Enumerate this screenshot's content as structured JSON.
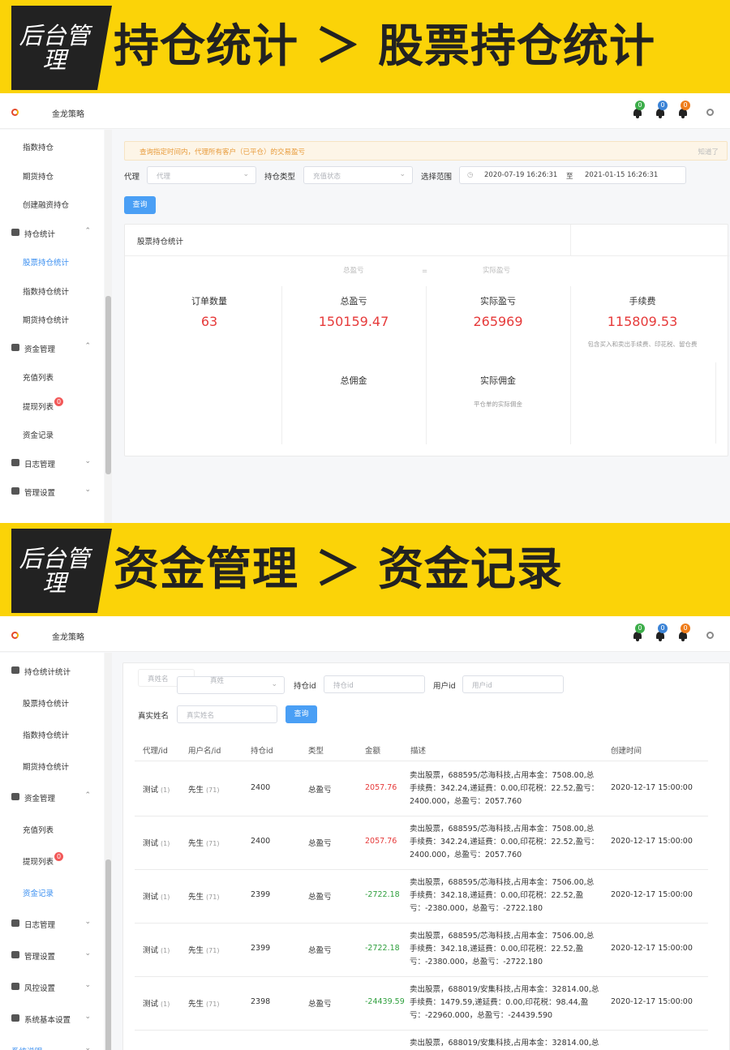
{
  "banner1": {
    "badge": "后台管理",
    "title": "持仓统计 ＞ 股票持仓统计"
  },
  "banner2": {
    "badge": "后台管理",
    "title": "资金管理 ＞ 资金记录"
  },
  "topbar": {
    "brand": "金龙策略",
    "badges": [
      {
        "count": "0",
        "color": "#3cad4a"
      },
      {
        "count": "0",
        "color": "#3b83d6"
      },
      {
        "count": "0",
        "color": "#ef7d1b"
      }
    ]
  },
  "screen1": {
    "sidebar": [
      {
        "label": "指数持仓",
        "kind": "sub"
      },
      {
        "label": "期货持仓",
        "kind": "sub"
      },
      {
        "label": "创建融资持仓",
        "kind": "sub"
      },
      {
        "label": "持仓统计",
        "kind": "grp",
        "arrow": "^"
      },
      {
        "label": "股票持仓统计",
        "kind": "sub",
        "active": true
      },
      {
        "label": "指数持仓统计",
        "kind": "sub"
      },
      {
        "label": "期货持仓统计",
        "kind": "sub"
      },
      {
        "label": "资金管理",
        "kind": "grp",
        "arrow": "^"
      },
      {
        "label": "充值列表",
        "kind": "sub"
      },
      {
        "label": "提现列表",
        "kind": "sub",
        "dot": "0"
      },
      {
        "label": "资金记录",
        "kind": "sub"
      },
      {
        "label": "日志管理",
        "kind": "grp",
        "arrow": "v"
      },
      {
        "label": "管理设置",
        "kind": "grp",
        "arrow": "v"
      }
    ],
    "alert": {
      "text": "查询指定时间内，代理所有客户（已平仓）的交易盈亏",
      "close": "知道了"
    },
    "filters": {
      "agent_label": "代理",
      "agent_placeholder": "代理",
      "type_label": "持仓类型",
      "type_placeholder": "充值状态",
      "range_label": "选择范围",
      "start": "2020-07-19 16:26:31",
      "sep": "至",
      "end": "2021-01-15 16:26:31",
      "query": "查询"
    },
    "card": {
      "title": "股票持仓统计",
      "ghost_left": "总盈亏",
      "ghost_mid": "=",
      "ghost_right": "实际盈亏",
      "stats": [
        {
          "label": "订单数量",
          "value": "63"
        },
        {
          "label": "总盈亏",
          "value": "150159.47"
        },
        {
          "label": "实际盈亏",
          "value": "265969"
        },
        {
          "label": "手续费",
          "value": "115809.53",
          "note": "包含买入和卖出手续费、印花税、留仓费"
        }
      ],
      "row2": [
        {
          "label": "总佣金"
        },
        {
          "label": "实际佣金",
          "note": "平仓单的实际佣金"
        }
      ]
    }
  },
  "screen2": {
    "sidebar": [
      {
        "label": "持仓统计统计",
        "kind": "grp",
        "arrow": ""
      },
      {
        "label": "股票持仓统计",
        "kind": "sub"
      },
      {
        "label": "指数持仓统计",
        "kind": "sub"
      },
      {
        "label": "期货持仓统计",
        "kind": "sub"
      },
      {
        "label": "资金管理",
        "kind": "grp",
        "arrow": "^"
      },
      {
        "label": "充值列表",
        "kind": "sub"
      },
      {
        "label": "提现列表",
        "kind": "sub",
        "dot": "0"
      },
      {
        "label": "资金记录",
        "kind": "sub",
        "active": true
      },
      {
        "label": "日志管理",
        "kind": "grp",
        "arrow": "v"
      },
      {
        "label": "管理设置",
        "kind": "grp",
        "arrow": "v"
      },
      {
        "label": "风控设置",
        "kind": "grp",
        "arrow": "v"
      },
      {
        "label": "系统基本设置",
        "kind": "grp",
        "arrow": "v"
      },
      {
        "label": "系统说明",
        "kind": "top",
        "arrow": "v",
        "active": true
      }
    ],
    "filters": {
      "name_placeholder": "真姓名",
      "name_placeholder2": "真姓",
      "position_label": "持仓id",
      "position_placeholder": "持仓id",
      "user_label": "用户id",
      "user_placeholder": "用户id",
      "realname_label": "真实姓名",
      "realname_placeholder": "真实姓名",
      "query": "查询"
    },
    "table": {
      "headers": [
        "代理/id",
        "用户名/id",
        "持仓id",
        "类型",
        "金额",
        "描述",
        "创建时间"
      ],
      "rows": [
        {
          "agent": "测试",
          "agent_id": "(1)",
          "user": "先生",
          "user_id": "(71)",
          "pos": "2400",
          "type": "总盈亏",
          "amount": "2057.76",
          "sign": "pos",
          "desc": "卖出股票，688595/芯海科技,占用本金：7508.00,总手续费：342.24,递延费：0.00,印花税：22.52,盈亏：2400.000，总盈亏：2057.760",
          "time": "2020-12-17 15:00:00"
        },
        {
          "agent": "测试",
          "agent_id": "(1)",
          "user": "先生",
          "user_id": "(71)",
          "pos": "2400",
          "type": "总盈亏",
          "amount": "2057.76",
          "sign": "pos",
          "desc": "卖出股票，688595/芯海科技,占用本金：7508.00,总手续费：342.24,递延费：0.00,印花税：22.52,盈亏：2400.000，总盈亏：2057.760",
          "time": "2020-12-17 15:00:00"
        },
        {
          "agent": "测试",
          "agent_id": "(1)",
          "user": "先生",
          "user_id": "(71)",
          "pos": "2399",
          "type": "总盈亏",
          "amount": "-2722.18",
          "sign": "neg",
          "desc": "卖出股票，688595/芯海科技,占用本金：7506.00,总手续费：342.18,递延费：0.00,印花税：22.52,盈亏：-2380.000，总盈亏：-2722.180",
          "time": "2020-12-17 15:00:00"
        },
        {
          "agent": "测试",
          "agent_id": "(1)",
          "user": "先生",
          "user_id": "(71)",
          "pos": "2399",
          "type": "总盈亏",
          "amount": "-2722.18",
          "sign": "neg",
          "desc": "卖出股票，688595/芯海科技,占用本金：7506.00,总手续费：342.18,递延费：0.00,印花税：22.52,盈亏：-2380.000，总盈亏：-2722.180",
          "time": "2020-12-17 15:00:00"
        },
        {
          "agent": "测试",
          "agent_id": "(1)",
          "user": "先生",
          "user_id": "(71)",
          "pos": "2398",
          "type": "总盈亏",
          "amount": "-24439.59",
          "sign": "neg",
          "desc": "卖出股票，688019/安集科技,占用本金：32814.00,总手续费：1479.59,递延费：0.00,印花税：98.44,盈亏：-22960.000，总盈亏：-24439.590",
          "time": "2020-12-17 15:00:00"
        },
        {
          "agent": "",
          "agent_id": "",
          "user": "",
          "user_id": "",
          "pos": "",
          "type": "",
          "amount": "",
          "sign": "neg",
          "desc": "卖出股票，688019/安集科技,占用本金：32814.00,总",
          "time": ""
        }
      ]
    }
  }
}
